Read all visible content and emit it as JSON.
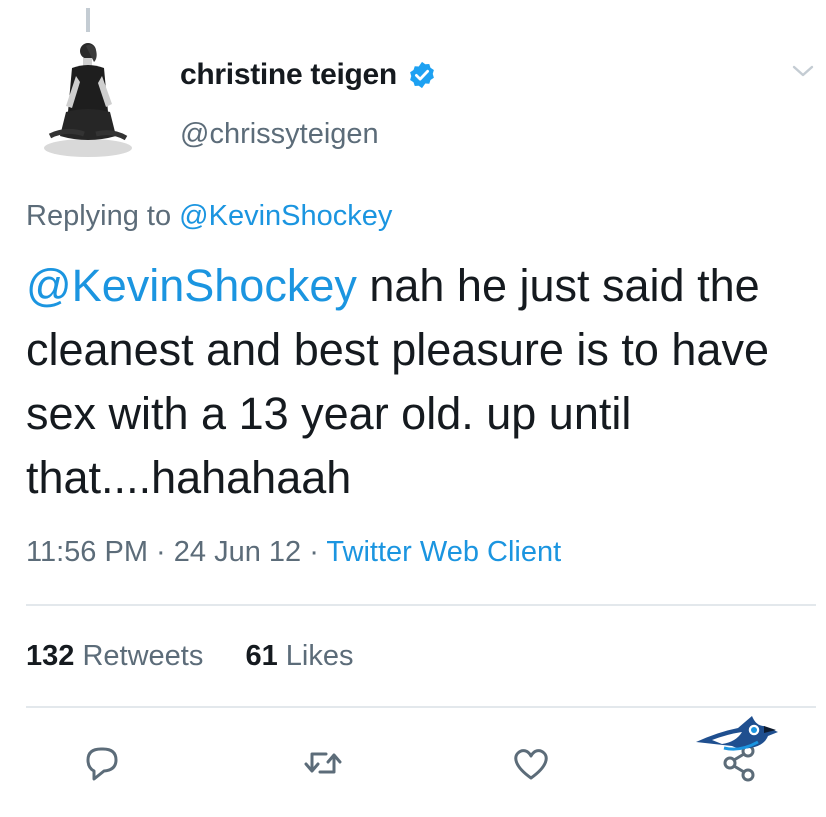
{
  "author": {
    "display_name": "christine teigen",
    "handle": "@chrissyteigen",
    "verified": true
  },
  "reply": {
    "prefix": "Replying to",
    "to_handle": "@KevinShockey"
  },
  "tweet": {
    "mention": "@KevinShockey",
    "text": " nah he just said the cleanest and best pleasure is to have sex with a 13 year old. up until that....hahahaah"
  },
  "meta": {
    "time": "11:56 PM",
    "separator": " · ",
    "date": "24 Jun 12",
    "client": "Twitter Web Client"
  },
  "stats": {
    "retweets_count": "132",
    "retweets_label": " Retweets",
    "likes_count": "61",
    "likes_label": " Likes"
  },
  "actions": [
    {
      "icon": "reply-icon"
    },
    {
      "icon": "retweet-icon"
    },
    {
      "icon": "like-icon"
    },
    {
      "icon": "share-icon"
    }
  ],
  "colors": {
    "link": "#1b95e0",
    "secondary_text": "#5c6c79",
    "verified_badge": "#1da1f2",
    "divider": "#e3e8ec"
  }
}
